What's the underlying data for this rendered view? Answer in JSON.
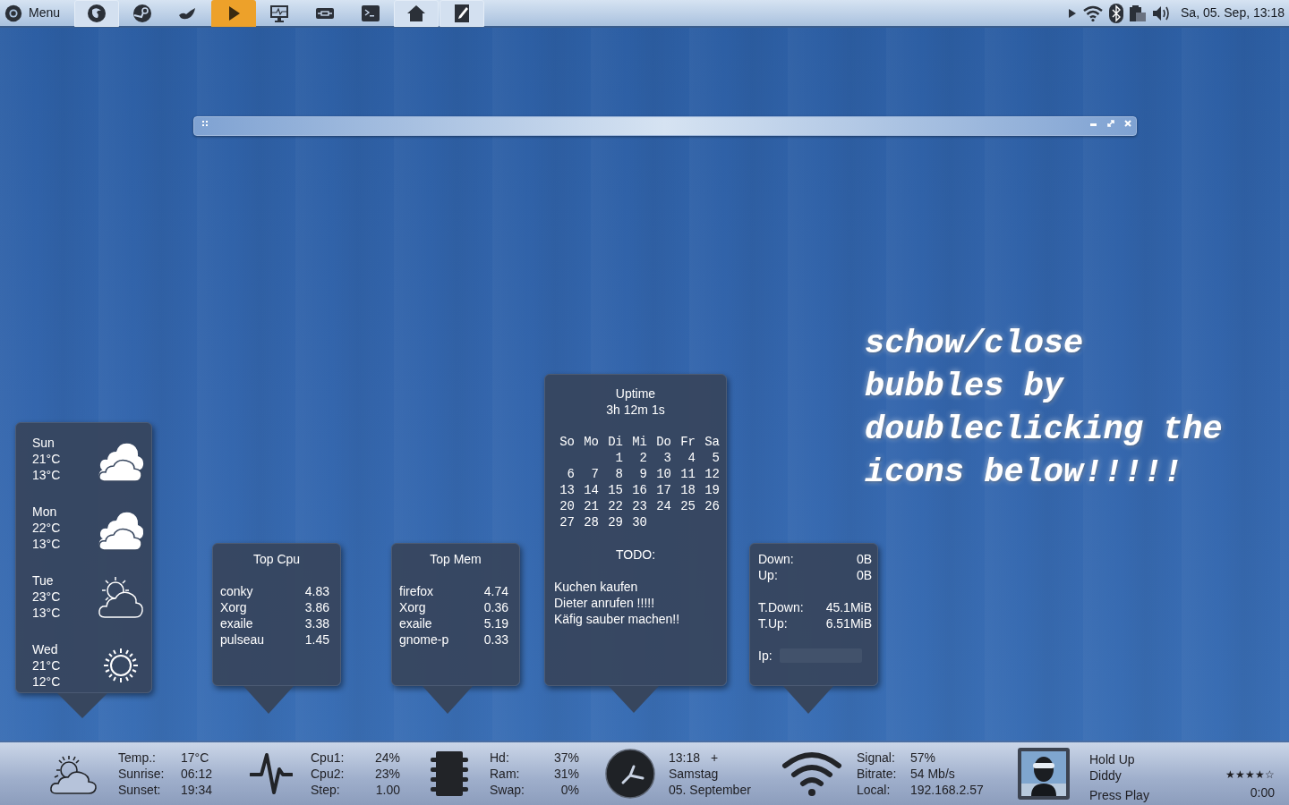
{
  "top_panel": {
    "menu_label": "Menu",
    "launchers": [
      {
        "kind": "firefox",
        "raised": true,
        "selected": false
      },
      {
        "kind": "steam",
        "raised": false,
        "selected": false
      },
      {
        "kind": "bird",
        "raised": false,
        "selected": false
      },
      {
        "kind": "play",
        "raised": false,
        "selected": true
      },
      {
        "kind": "monitor",
        "raised": false,
        "selected": false
      },
      {
        "kind": "connector",
        "raised": false,
        "selected": false
      },
      {
        "kind": "terminal",
        "raised": false,
        "selected": false
      },
      {
        "kind": "home",
        "raised": true,
        "selected": false
      },
      {
        "kind": "pencil",
        "raised": true,
        "selected": false
      }
    ],
    "clock": "Sa, 05. Sep, 13:18"
  },
  "bubbles": {
    "weather": [
      {
        "day": "Sun",
        "high": "21°C",
        "low": "13°C",
        "kind": "cloudy"
      },
      {
        "day": "Mon",
        "high": "22°C",
        "low": "13°C",
        "kind": "cloudy"
      },
      {
        "day": "Tue",
        "high": "23°C",
        "low": "13°C",
        "kind": "partly_cloudy"
      },
      {
        "day": "Wed",
        "high": "21°C",
        "low": "12°C",
        "kind": "sunny"
      }
    ],
    "top_cpu": {
      "title": "Top Cpu",
      "rows": [
        {
          "name": "conky",
          "value": "4.83"
        },
        {
          "name": "Xorg",
          "value": "3.86"
        },
        {
          "name": "exaile",
          "value": "3.38"
        },
        {
          "name": "pulseau",
          "value": "1.45"
        }
      ]
    },
    "top_mem": {
      "title": "Top Mem",
      "rows": [
        {
          "name": "firefox",
          "value": "4.74"
        },
        {
          "name": "Xorg",
          "value": "0.36"
        },
        {
          "name": "exaile",
          "value": "5.19"
        },
        {
          "name": "gnome-p",
          "value": "0.33"
        }
      ]
    },
    "uptime": {
      "title": "Uptime",
      "value": "3h 12m 1s",
      "calendar": {
        "weekdays": [
          "So",
          "Mo",
          "Di",
          "Mi",
          "Do",
          "Fr",
          "Sa"
        ],
        "weeks": [
          [
            "1",
            "2",
            "3",
            "4",
            "5"
          ],
          [
            "6",
            "7",
            "8",
            "9",
            "10",
            "11",
            "12"
          ],
          [
            "13",
            "14",
            "15",
            "16",
            "17",
            "18",
            "19"
          ],
          [
            "20",
            "21",
            "22",
            "23",
            "24",
            "25",
            "26"
          ],
          [
            "27",
            "28",
            "29",
            "30"
          ]
        ]
      },
      "todo_title": "TODO:",
      "todo": [
        "Kuchen kaufen",
        "Dieter anrufen !!!!!",
        "Käfig sauber machen!!"
      ]
    },
    "network": [
      [
        {
          "label": "Down:",
          "value": "0B"
        },
        {
          "label": "Up:",
          "value": "0B"
        }
      ],
      [
        {
          "label": "T.Down:",
          "value": "45.1MiB"
        },
        {
          "label": "T.Up:",
          "value": "6.51MiB"
        }
      ],
      [
        {
          "label": "Ip:",
          "redacted": true
        }
      ]
    ]
  },
  "hint": [
    "schow/close",
    "bubbles by",
    "doubleclicking the",
    "icons below!!!!!"
  ],
  "bottom_bar": {
    "weather": [
      {
        "label": "Temp.:",
        "value": "17°C"
      },
      {
        "label": "Sunrise:",
        "value": "06:12"
      },
      {
        "label": "Sunset:",
        "value": "19:34"
      }
    ],
    "cpu": [
      {
        "label": "Cpu1:",
        "value": "24%"
      },
      {
        "label": "Cpu2:",
        "value": "23%"
      },
      {
        "label": "Step:",
        "value": "1.00"
      }
    ],
    "memory": [
      {
        "label": "Hd:",
        "value": "37%"
      },
      {
        "label": "Ram:",
        "value": "31%"
      },
      {
        "label": "Swap:",
        "value": "0%"
      }
    ],
    "clock": {
      "time": "13:18",
      "extra": "+",
      "day": "Samstag",
      "date": "05. September"
    },
    "wifi": [
      {
        "label": "Signal:",
        "value": "57%"
      },
      {
        "label": "Bitrate:",
        "value": "54 Mb/s"
      },
      {
        "label": "Local:",
        "value": "192.168.2.57"
      }
    ],
    "music": {
      "title": "Hold Up",
      "artist": "Diddy",
      "status": "Press Play",
      "stars": 4,
      "time": "0:00"
    }
  }
}
